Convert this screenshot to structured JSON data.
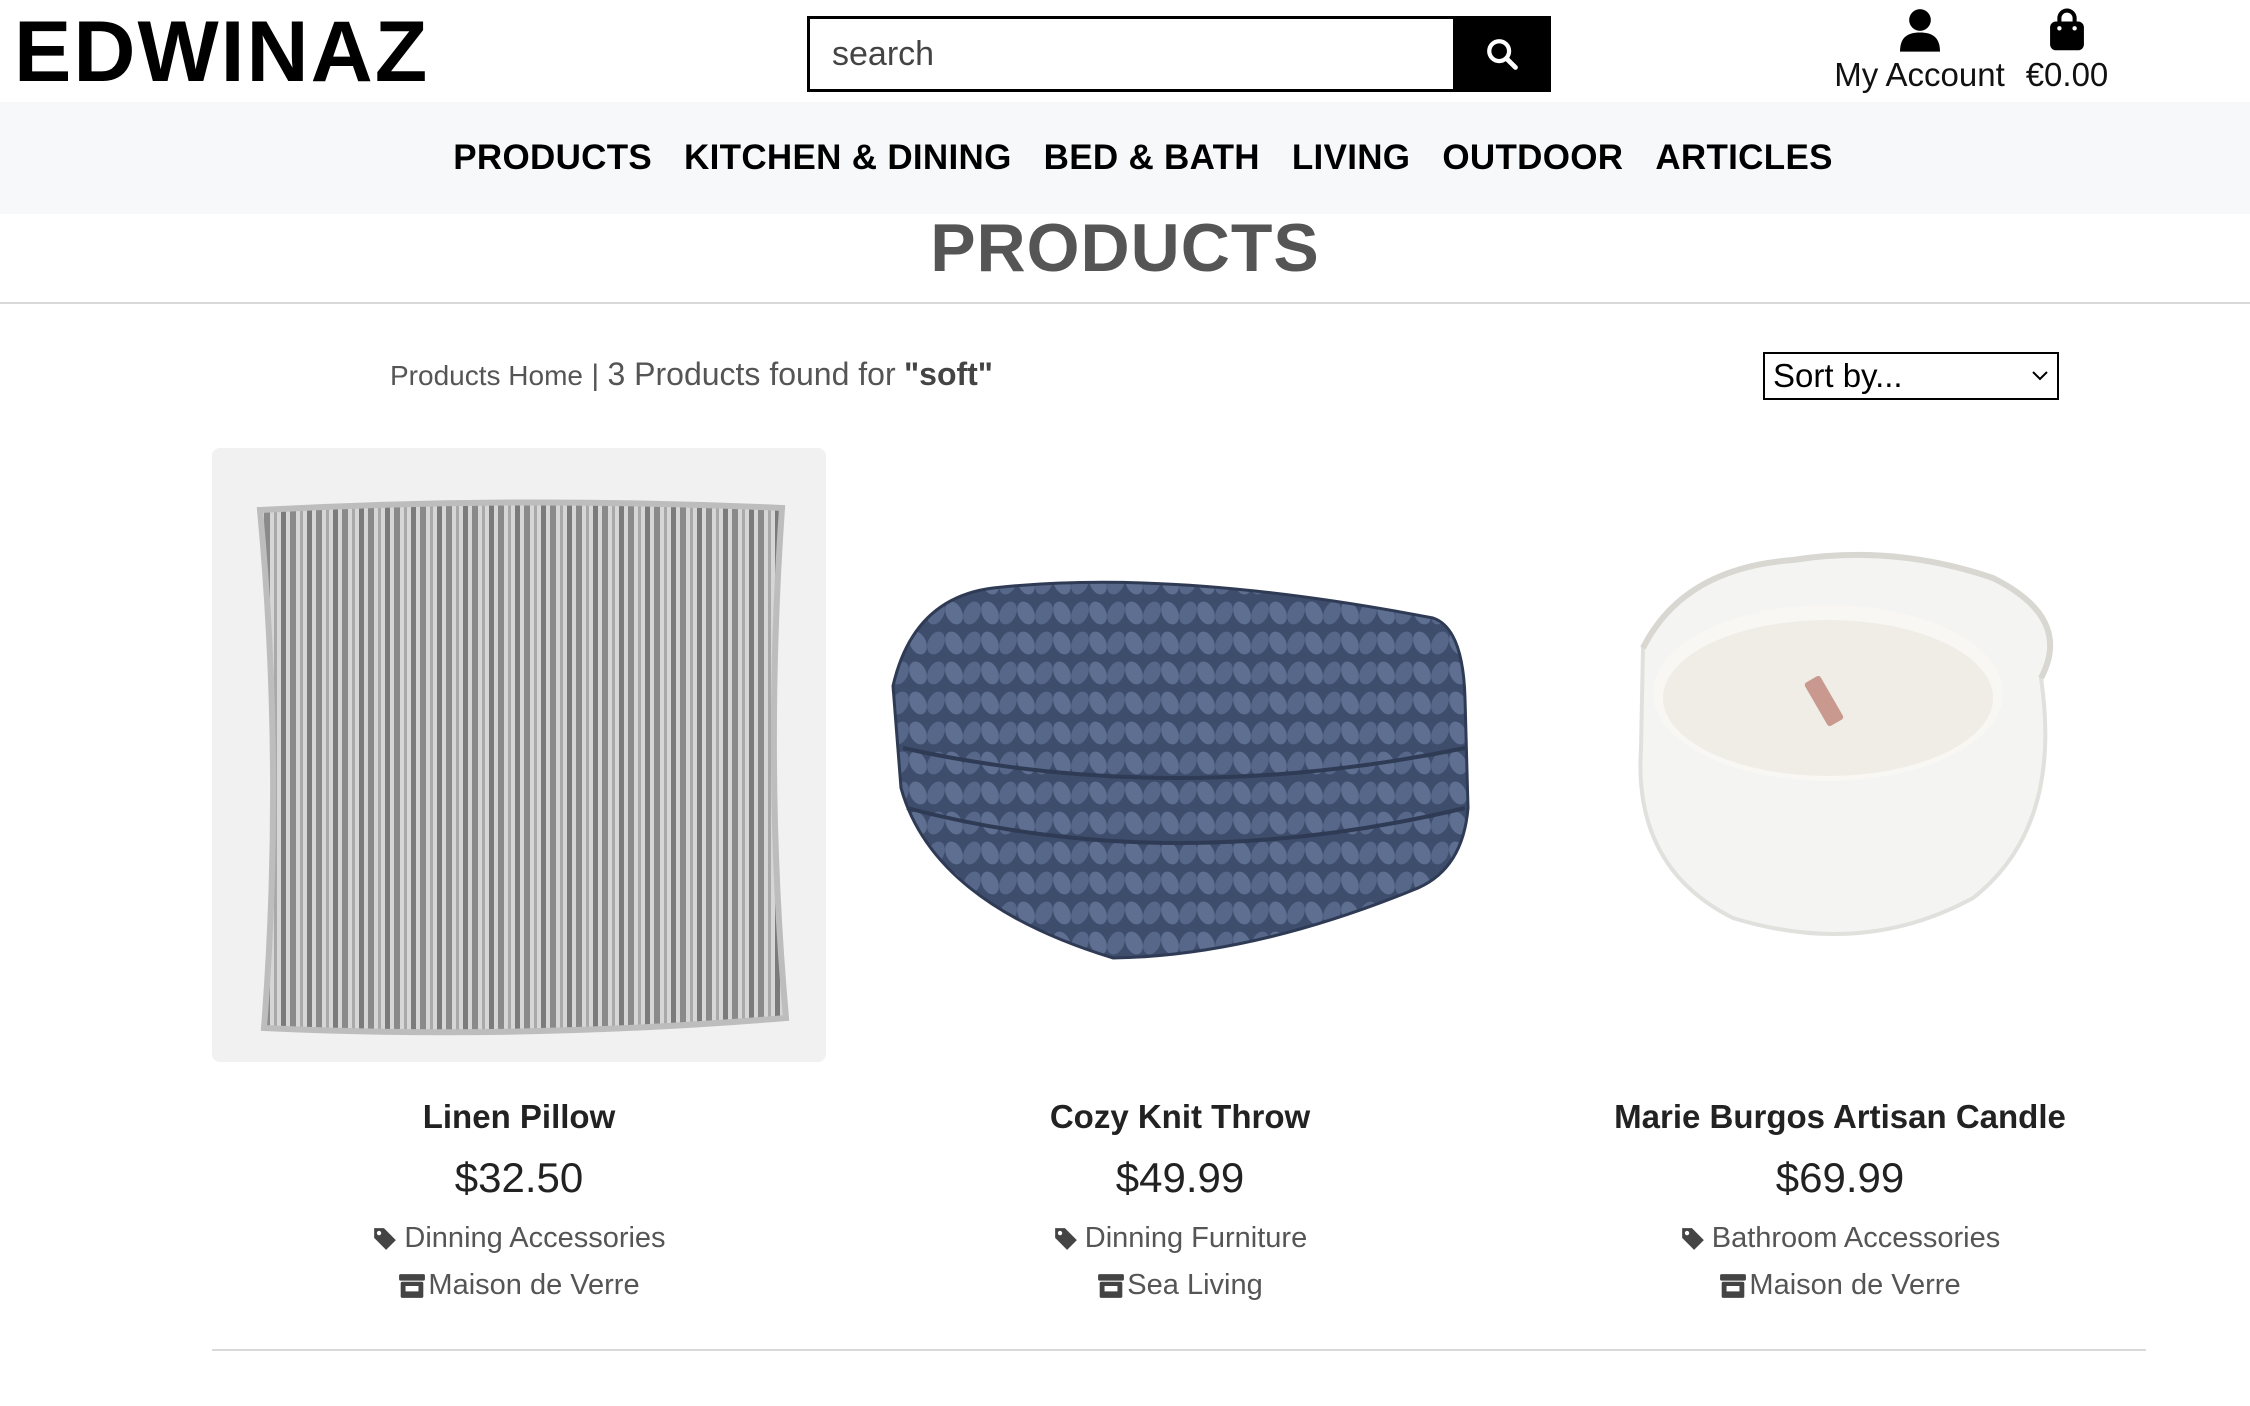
{
  "brand": {
    "name": "EDWINAZ"
  },
  "search": {
    "placeholder": "search"
  },
  "account": {
    "label": "My Account"
  },
  "cart": {
    "total": "€0.00"
  },
  "nav": {
    "items": [
      {
        "label": "PRODUCTS"
      },
      {
        "label": "KITCHEN & DINING"
      },
      {
        "label": "BED & BATH"
      },
      {
        "label": "LIVING"
      },
      {
        "label": "OUTDOOR"
      },
      {
        "label": "ARTICLES"
      }
    ]
  },
  "page": {
    "title": "PRODUCTS",
    "breadcrumb_home": "Products Home",
    "separator": "|",
    "results_text": "3 Products found for",
    "query": "\"soft\"",
    "sort_label": "Sort by..."
  },
  "products": [
    {
      "name": "Linen Pillow",
      "price": "$32.50",
      "category": "Dinning Accessories",
      "brand": "Maison de Verre"
    },
    {
      "name": "Cozy Knit Throw",
      "price": "$49.99",
      "category": "Dinning Furniture",
      "brand": "Sea Living"
    },
    {
      "name": "Marie Burgos Artisan Candle",
      "price": "$69.99",
      "category": "Bathroom Accessories",
      "brand": "Maison de Verre"
    }
  ],
  "icons": {
    "search": "search-icon",
    "account": "user-icon",
    "cart": "shopping-bag-icon",
    "category": "tag-icon",
    "brand": "store-icon"
  },
  "colors": {
    "header_bg": "#ffffff",
    "nav_bg": "#f7f8f9",
    "button_bg": "#000000",
    "title_text": "#555555"
  }
}
